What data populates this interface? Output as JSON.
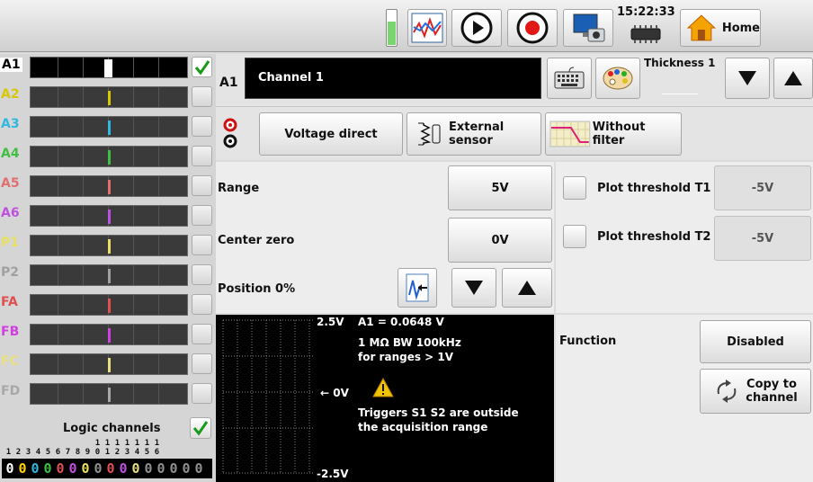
{
  "topbar": {
    "time": "15:22:33",
    "home_label": "Home"
  },
  "channels": [
    {
      "id": "A1",
      "color": "#000000",
      "mark_color": "#ffffff",
      "selected": true,
      "checked": true
    },
    {
      "id": "A2",
      "color": "#d8c800",
      "mark_color": "#d8c800",
      "selected": false,
      "checked": false
    },
    {
      "id": "A3",
      "color": "#30b8e0",
      "mark_color": "#30b8e0",
      "selected": false,
      "checked": false
    },
    {
      "id": "A4",
      "color": "#40c040",
      "mark_color": "#40c040",
      "selected": false,
      "checked": false
    },
    {
      "id": "A5",
      "color": "#e07070",
      "mark_color": "#e07070",
      "selected": false,
      "checked": false
    },
    {
      "id": "A6",
      "color": "#c050e0",
      "mark_color": "#c050e0",
      "selected": false,
      "checked": false
    },
    {
      "id": "P1",
      "color": "#e8e060",
      "mark_color": "#e8e060",
      "selected": false,
      "checked": false
    },
    {
      "id": "P2",
      "color": "#a0a0a0",
      "mark_color": "#a0a0a0",
      "selected": false,
      "checked": false
    },
    {
      "id": "FA",
      "color": "#e05050",
      "mark_color": "#e05050",
      "selected": false,
      "checked": false
    },
    {
      "id": "FB",
      "color": "#d040e0",
      "mark_color": "#d040e0",
      "selected": false,
      "checked": false
    },
    {
      "id": "FC",
      "color": "#e8e080",
      "mark_color": "#e8e080",
      "selected": false,
      "checked": false
    },
    {
      "id": "FD",
      "color": "#a8a8a8",
      "mark_color": "#a8a8a8",
      "selected": false,
      "checked": false
    }
  ],
  "logic": {
    "label": "Logic channels",
    "checked": true,
    "index_top": [
      "",
      "",
      "",
      "",
      "",
      "",
      "",
      "",
      "1",
      "1",
      "1",
      "1",
      "1",
      "1",
      "1"
    ],
    "index_bottom": [
      "1",
      "2",
      "3",
      "4",
      "5",
      "6",
      "7",
      "8",
      "9",
      "0",
      "1",
      "2",
      "3",
      "4",
      "5",
      "6"
    ],
    "bits": [
      "0",
      "0",
      "0",
      "0",
      "0",
      "0",
      "0",
      "0",
      "0",
      "0",
      "0",
      "0",
      "0",
      "0",
      "0",
      "0"
    ],
    "bit_colors": [
      "#ffffff",
      "#ffd400",
      "#30b8e0",
      "#40c040",
      "#e05050",
      "#c050e0",
      "#e8e060",
      "#909090",
      "#e05050",
      "#c050e0",
      "#e8e080",
      "#909090",
      "#909090",
      "#909090",
      "#909090",
      "#909090"
    ]
  },
  "channel_header": {
    "id": "A1",
    "name": "Channel 1",
    "thickness_label": "Thickness 1"
  },
  "input": {
    "mode": "Voltage direct",
    "sensor_line1": "External",
    "sensor_line2": "sensor",
    "filter": "Without filter"
  },
  "range": {
    "label": "Range",
    "value": "5V"
  },
  "center": {
    "label": "Center zero",
    "value": "0V"
  },
  "position": {
    "label": "Position 0%"
  },
  "thresholds": [
    {
      "label": "Plot threshold T1",
      "value": "-5V"
    },
    {
      "label": "Plot threshold T2",
      "value": "-5V"
    }
  ],
  "preview": {
    "top": "2.5V",
    "mid": "← 0V",
    "bottom": "-2.5V",
    "reading": "A1 = 0.0648 V",
    "info1": "1 MΩ BW 100kHz",
    "info2": "for ranges > 1V",
    "warn1": "Triggers S1 S2 are outside",
    "warn2": "the acquisition range"
  },
  "function": {
    "label": "Function",
    "value": "Disabled",
    "copy1": "Copy to",
    "copy2": "channel"
  }
}
